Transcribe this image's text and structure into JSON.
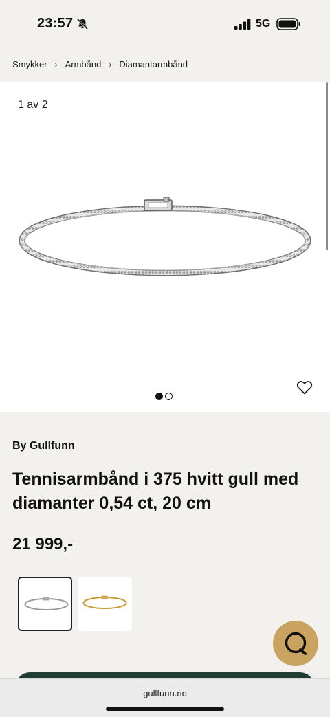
{
  "status_bar": {
    "time": "23:57",
    "network": "5G",
    "bell_icon": "bell-slash-icon",
    "signal_icon": "signal-bars-icon",
    "battery_icon": "battery-full-icon"
  },
  "breadcrumb": {
    "items": [
      "Smykker",
      "Armbånd",
      "Diamantarmbånd"
    ],
    "separator": "›"
  },
  "gallery": {
    "counter": "1 av 2",
    "total_images": 2,
    "active_index": 0,
    "favorite_icon": "heart-icon"
  },
  "product": {
    "brand": "By Gullfunn",
    "title": "Tennisarmbånd i 375 hvitt gull med diamanter 0,54 ct, 20 cm",
    "price": "21 999,-"
  },
  "variants": [
    {
      "name": "white-gold",
      "color": "#9a9a9a",
      "selected": true
    },
    {
      "name": "yellow-gold",
      "color": "#c99a2e",
      "selected": false
    }
  ],
  "chat": {
    "icon": "chat-bubble-icon",
    "color": "#c9a35f"
  },
  "browser": {
    "url": "gullfunn.no"
  },
  "colors": {
    "background": "#f3f1ee",
    "cta": "#1f3b33",
    "accent": "#c9a35f"
  }
}
